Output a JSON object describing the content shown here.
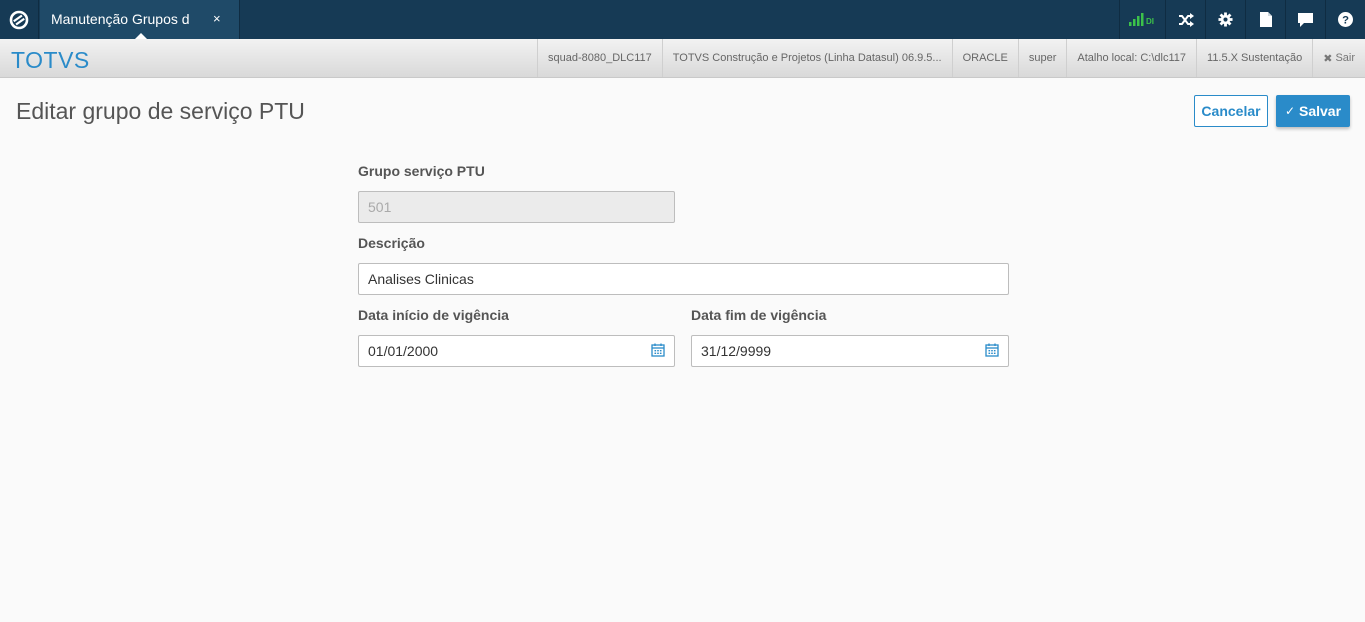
{
  "topbar": {
    "tab_label": "Manutenção Grupos d",
    "tab_close": "×",
    "signal_text": "DI"
  },
  "infobar": {
    "brand": "TOTVS",
    "items": [
      "squad-8080_DLC117",
      "TOTVS Construção e Projetos (Linha Datasul) 06.9.5...",
      "ORACLE",
      "super",
      "Atalho local: C:\\dlc117",
      "11.5.X Sustentação"
    ],
    "sair": "Sair"
  },
  "page": {
    "title": "Editar grupo de serviço PTU",
    "cancel_label": "Cancelar",
    "save_label": "Salvar"
  },
  "form": {
    "grupo_label": "Grupo serviço PTU",
    "grupo_value": "501",
    "descricao_label": "Descrição",
    "descricao_value": "Analises Clinicas",
    "inicio_label": "Data início de vigência",
    "inicio_value": "01/01/2000",
    "fim_label": "Data fim de vigência",
    "fim_value": "31/12/9999"
  },
  "colors": {
    "topbar": "#163a55",
    "accent": "#2a8bc9",
    "signal": "#3cc24a"
  }
}
